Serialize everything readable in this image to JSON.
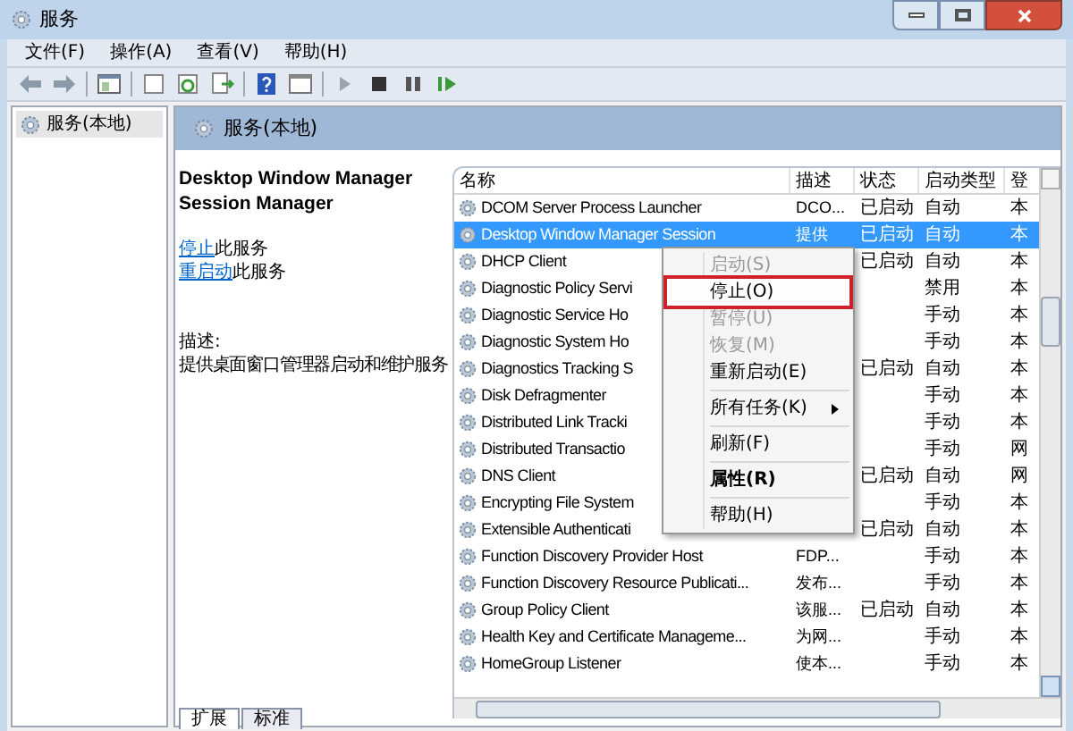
{
  "window": {
    "title": "服务"
  },
  "menu": [
    "文件(F)",
    "操作(A)",
    "查看(V)",
    "帮助(H)"
  ],
  "tree": {
    "label": "服务(本地)",
    "selected": true
  },
  "pane_header": "服务(本地)",
  "details": {
    "title": "Desktop Window Manager Session Manager",
    "links": [
      {
        "link": "停止",
        "text": "此服务"
      },
      {
        "link": "重启动",
        "text": "此服务"
      }
    ],
    "description_label": "描述:",
    "description": "提供桌面窗口管理器启动和维护服务"
  },
  "table": {
    "columns": [
      "名称",
      "描述",
      "状态",
      "启动类型",
      "登"
    ],
    "rows": [
      {
        "name": "DCOM Server Process Launcher",
        "desc": "DCO...",
        "status": "已启动",
        "startup": "自动",
        "logon": "本",
        "selected": false
      },
      {
        "name": "Desktop Window Manager Session",
        "desc": "提供",
        "status": "已启动",
        "startup": "自动",
        "logon": "本",
        "selected": true
      },
      {
        "name": "DHCP Client",
        "status": "已启动",
        "startup": "自动",
        "logon": "本",
        "selected": false
      },
      {
        "name": "Diagnostic Policy Servi",
        "startup": "禁用",
        "logon": "本",
        "selected": false
      },
      {
        "name": "Diagnostic Service Ho",
        "startup": "手动",
        "logon": "本",
        "selected": false
      },
      {
        "name": "Diagnostic System Ho",
        "startup": "手动",
        "logon": "本",
        "selected": false
      },
      {
        "name": "Diagnostics Tracking S",
        "status": "已启动",
        "startup": "自动",
        "logon": "本",
        "selected": false
      },
      {
        "name": "Disk Defragmenter",
        "startup": "手动",
        "logon": "本",
        "selected": false
      },
      {
        "name": "Distributed Link Tracki",
        "startup": "手动",
        "logon": "本",
        "selected": false
      },
      {
        "name": "Distributed Transactio",
        "startup": "手动",
        "logon": "网",
        "selected": false
      },
      {
        "name": "DNS Client",
        "status": "已启动",
        "startup": "自动",
        "logon": "网",
        "selected": false
      },
      {
        "name": "Encrypting File System",
        "startup": "手动",
        "logon": "本",
        "selected": false
      },
      {
        "name": "Extensible Authenticati",
        "status": "已启动",
        "startup": "自动",
        "logon": "本",
        "selected": false
      },
      {
        "name": "Function Discovery Provider Host",
        "desc": "FDP...",
        "startup": "手动",
        "logon": "本",
        "selected": false
      },
      {
        "name": "Function Discovery Resource Publicati...",
        "desc": "发布...",
        "startup": "手动",
        "logon": "本",
        "selected": false
      },
      {
        "name": "Group Policy Client",
        "desc": "该服...",
        "status": "已启动",
        "startup": "自动",
        "logon": "本",
        "selected": false
      },
      {
        "name": "Health Key and Certificate Manageme...",
        "desc": "为网...",
        "startup": "手动",
        "logon": "本",
        "selected": false
      },
      {
        "name": "HomeGroup Listener",
        "desc": "使本...",
        "startup": "手动",
        "logon": "本",
        "selected": false
      }
    ]
  },
  "context_menu": [
    {
      "kind": "item",
      "label": "启动(S)",
      "disabled": true,
      "selected": false
    },
    {
      "kind": "item",
      "label": "停止(O)",
      "disabled": false,
      "selected": true
    },
    {
      "kind": "item",
      "label": "暂停(U)",
      "disabled": true,
      "selected": false
    },
    {
      "kind": "item",
      "label": "恢复(M)",
      "disabled": true,
      "selected": false
    },
    {
      "kind": "item",
      "label": "重新启动(E)",
      "disabled": false,
      "selected": false
    },
    {
      "kind": "separator"
    },
    {
      "kind": "submenu",
      "label": "所有任务(K)",
      "disabled": false,
      "selected": false
    },
    {
      "kind": "separator"
    },
    {
      "kind": "item",
      "label": "刷新(F)",
      "disabled": false,
      "selected": false
    },
    {
      "kind": "separator"
    },
    {
      "kind": "default",
      "label": "属性(R)",
      "disabled": false,
      "selected": false
    },
    {
      "kind": "separator"
    },
    {
      "kind": "item",
      "label": "帮助(H)",
      "disabled": false,
      "selected": false
    }
  ],
  "bottom_tabs": [
    {
      "label": "扩展",
      "selected": true
    },
    {
      "label": "标准",
      "selected": false
    }
  ]
}
